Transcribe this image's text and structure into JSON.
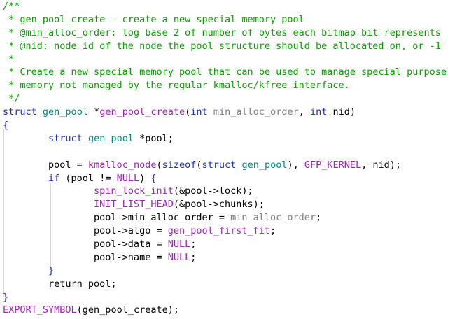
{
  "editor": {
    "lines": [
      [
        {
          "t": "/**",
          "c": "cm"
        }
      ],
      [
        {
          "t": " * gen_pool_create - create a new special memory pool",
          "c": "cm"
        }
      ],
      [
        {
          "t": " * @min_alloc_order: log base 2 of number of bytes each bitmap bit represents",
          "c": "cm"
        }
      ],
      [
        {
          "t": " * @nid: node id of the node the pool structure should be allocated on, or -1",
          "c": "cm"
        }
      ],
      [
        {
          "t": " *",
          "c": "cm"
        }
      ],
      [
        {
          "t": " * Create a new special memory pool that can be used to manage special purpose",
          "c": "cm"
        }
      ],
      [
        {
          "t": " * memory not managed by the regular kmalloc/kfree interface.",
          "c": "cm"
        }
      ],
      [
        {
          "t": " */",
          "c": "cm"
        }
      ],
      [
        {
          "t": "struct",
          "c": "kw"
        },
        {
          "t": " "
        },
        {
          "t": "gen_pool",
          "c": "ty"
        },
        {
          "t": " *"
        },
        {
          "t": "gen_pool_create",
          "c": "fn"
        },
        {
          "t": "("
        },
        {
          "t": "int",
          "c": "kw"
        },
        {
          "t": " "
        },
        {
          "t": "min_alloc_order",
          "c": "pm"
        },
        {
          "t": ", "
        },
        {
          "t": "int",
          "c": "kw"
        },
        {
          "t": " nid)"
        }
      ],
      [
        {
          "t": "{",
          "c": "kw"
        }
      ],
      [
        {
          "t": "        "
        },
        {
          "t": "struct",
          "c": "kw"
        },
        {
          "t": " "
        },
        {
          "t": "gen_pool",
          "c": "ty"
        },
        {
          "t": " *pool;"
        }
      ],
      [
        {
          "t": ""
        }
      ],
      [
        {
          "t": "        pool = "
        },
        {
          "t": "kmalloc_node",
          "c": "fn"
        },
        {
          "t": "("
        },
        {
          "t": "sizeof",
          "c": "kw"
        },
        {
          "t": "("
        },
        {
          "t": "struct",
          "c": "kw"
        },
        {
          "t": " "
        },
        {
          "t": "gen_pool",
          "c": "ty"
        },
        {
          "t": "), "
        },
        {
          "t": "GFP_KERNEL",
          "c": "nl"
        },
        {
          "t": ", nid);"
        }
      ],
      [
        {
          "t": "        "
        },
        {
          "t": "if",
          "c": "kw"
        },
        {
          "t": " (pool != "
        },
        {
          "t": "NULL",
          "c": "nl"
        },
        {
          "t": ") "
        },
        {
          "t": "{",
          "c": "kw"
        }
      ],
      [
        {
          "t": "                "
        },
        {
          "t": "spin_lock_init",
          "c": "fn"
        },
        {
          "t": "(&pool->lock);"
        }
      ],
      [
        {
          "t": "                "
        },
        {
          "t": "INIT_LIST_HEAD",
          "c": "fn"
        },
        {
          "t": "(&pool->chunks);"
        }
      ],
      [
        {
          "t": "                pool->min_alloc_order = "
        },
        {
          "t": "min_alloc_order",
          "c": "pm"
        },
        {
          "t": ";"
        }
      ],
      [
        {
          "t": "                pool->algo = "
        },
        {
          "t": "gen_pool_first_fit",
          "c": "fn"
        },
        {
          "t": ";"
        }
      ],
      [
        {
          "t": "                pool->data = "
        },
        {
          "t": "NULL",
          "c": "nl"
        },
        {
          "t": ";"
        }
      ],
      [
        {
          "t": "                pool->name = "
        },
        {
          "t": "NULL",
          "c": "nl"
        },
        {
          "t": ";"
        }
      ],
      [
        {
          "t": "        "
        },
        {
          "t": "}",
          "c": "kw"
        }
      ],
      [
        {
          "t": "        return pool;"
        }
      ],
      [
        {
          "t": "}",
          "c": "kw"
        }
      ],
      [
        {
          "t": "EXPORT_SYMBOL",
          "c": "fn"
        },
        {
          "t": "(gen_pool_create);"
        }
      ]
    ]
  },
  "colors": {
    "comment": "#0aa000",
    "keyword": "#1f2fbf",
    "type": "#00897b",
    "function": "#9c27b0",
    "parameter": "#808080",
    "constant": "#9c27b0",
    "text": "#000000",
    "background": "#ffffff"
  }
}
